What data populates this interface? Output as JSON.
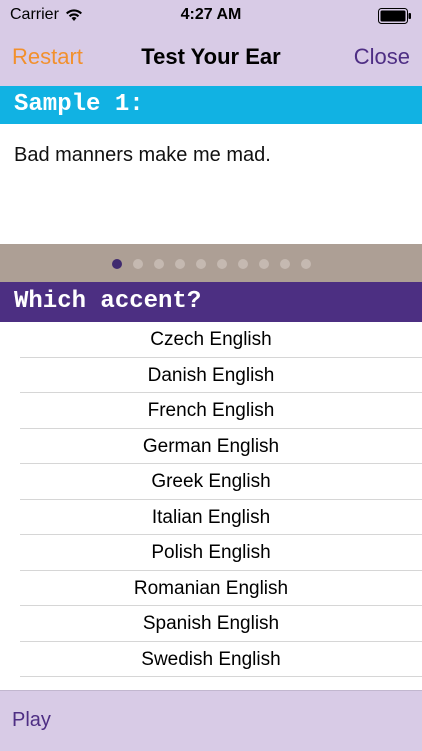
{
  "status_bar": {
    "carrier": "Carrier",
    "time": "4:27 AM",
    "wifi_icon": "wifi-icon",
    "battery_icon": "battery-icon"
  },
  "nav": {
    "left": "Restart",
    "title": "Test Your Ear",
    "right": "Close"
  },
  "sample": {
    "header": "Sample 1:",
    "text": "Bad manners make me mad."
  },
  "pager": {
    "total": 10,
    "active_index": 0
  },
  "question": {
    "header": "Which accent?",
    "options": [
      "Czech English",
      "Danish English",
      "French English",
      "German English",
      "Greek English",
      "Italian English",
      "Polish English",
      "Romanian English",
      "Spanish English",
      "Swedish English"
    ]
  },
  "toolbar": {
    "play": "Play"
  },
  "colors": {
    "nav_bg": "#d8cbe6",
    "restart": "#f2902d",
    "close": "#4e2e84",
    "sample_bar": "#11b2e3",
    "pager_bar": "#ad9f95",
    "question_bar": "#4c2f82"
  }
}
